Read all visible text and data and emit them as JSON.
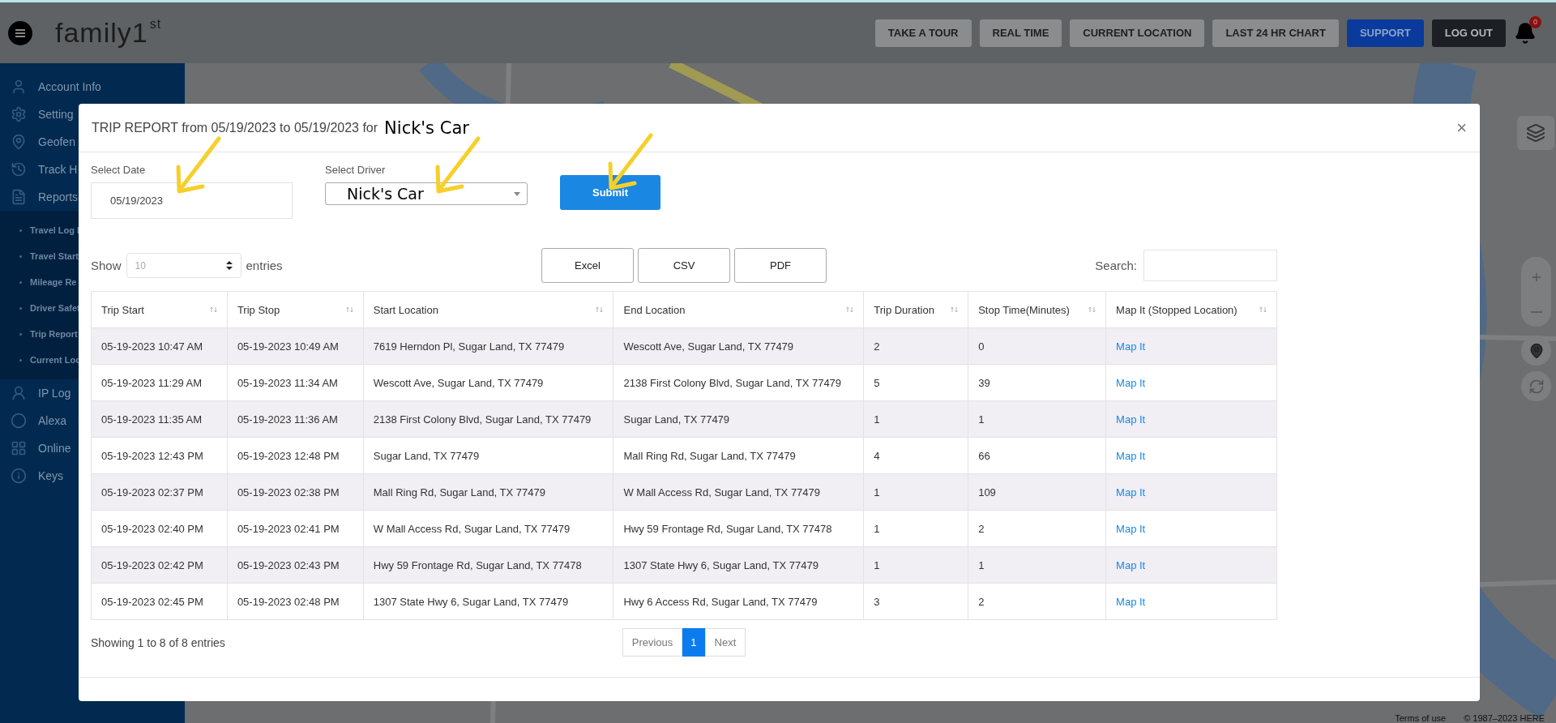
{
  "header": {
    "logo": "family1",
    "logo_sup": "st",
    "notifications": "0",
    "buttons": [
      {
        "label": "TAKE A TOUR",
        "kind": "default"
      },
      {
        "label": "REAL TIME",
        "kind": "default"
      },
      {
        "label": "CURRENT LOCATION",
        "kind": "default"
      },
      {
        "label": "LAST 24 HR CHART",
        "kind": "default"
      },
      {
        "label": "SUPPORT",
        "kind": "primary"
      },
      {
        "label": "LOG OUT",
        "kind": "dark"
      }
    ]
  },
  "sidebar": {
    "items": [
      {
        "label": "Account Info"
      },
      {
        "label": "Setting"
      },
      {
        "label": "Geofen"
      },
      {
        "label": "Track H"
      },
      {
        "label": "Reports",
        "expanded": true,
        "children": [
          {
            "label": "Travel Log I"
          },
          {
            "label": "Travel Start"
          },
          {
            "label": "Mileage Re"
          },
          {
            "label": "Driver Safet"
          },
          {
            "label": "Trip Report"
          },
          {
            "label": "Current Loc"
          }
        ]
      },
      {
        "label": "IP Log"
      },
      {
        "label": "Alexa"
      },
      {
        "label": "Online"
      },
      {
        "label": "Keys"
      }
    ]
  },
  "map": {
    "terms": "Terms of use",
    "copyright": "© 1987–2023 HERE"
  },
  "modal": {
    "title": "TRIP REPORT from 05/19/2023 to 05/19/2023 for",
    "title_vehicle": "Nick's Car",
    "close": "×",
    "date_label": "Select Date",
    "date_value": "05/19/2023",
    "driver_label": "Select Driver",
    "driver_value": "Nick's Car",
    "submit": "Submit",
    "show_label": "Show",
    "page_length": "10",
    "entries_label": "entries",
    "export_buttons": [
      "Excel",
      "CSV",
      "PDF"
    ],
    "search_label": "Search:",
    "table": {
      "columns": [
        {
          "label": "Trip Start",
          "kind": "text"
        },
        {
          "label": "Trip Stop",
          "kind": "text"
        },
        {
          "label": "Start Location",
          "kind": "text"
        },
        {
          "label": "End Location",
          "kind": "text"
        },
        {
          "label": "Trip Duration",
          "kind": "text"
        },
        {
          "label": "Stop Time(Minutes)",
          "kind": "text"
        },
        {
          "label": "Map It (Stopped Location)",
          "kind": "link"
        }
      ],
      "rows": [
        [
          "05-19-2023 10:47 AM",
          "05-19-2023 10:49 AM",
          "7619 Herndon Pl, Sugar Land, TX 77479",
          "Wescott Ave, Sugar Land, TX 77479",
          "2",
          "0",
          "Map It"
        ],
        [
          "05-19-2023 11:29 AM",
          "05-19-2023 11:34 AM",
          "Wescott Ave, Sugar Land, TX 77479",
          "2138 First Colony Blvd, Sugar Land, TX 77479",
          "5",
          "39",
          "Map It"
        ],
        [
          "05-19-2023 11:35 AM",
          "05-19-2023 11:36 AM",
          "2138 First Colony Blvd, Sugar Land, TX 77479",
          "Sugar Land, TX 77479",
          "1",
          "1",
          "Map It"
        ],
        [
          "05-19-2023 12:43 PM",
          "05-19-2023 12:48 PM",
          "Sugar Land, TX 77479",
          "Mall Ring Rd, Sugar Land, TX 77479",
          "4",
          "66",
          "Map It"
        ],
        [
          "05-19-2023 02:37 PM",
          "05-19-2023 02:38 PM",
          "Mall Ring Rd, Sugar Land, TX 77479",
          "W Mall Access Rd, Sugar Land, TX 77479",
          "1",
          "109",
          "Map It"
        ],
        [
          "05-19-2023 02:40 PM",
          "05-19-2023 02:41 PM",
          "W Mall Access Rd, Sugar Land, TX 77479",
          "Hwy 59 Frontage Rd, Sugar Land, TX 77478",
          "1",
          "2",
          "Map It"
        ],
        [
          "05-19-2023 02:42 PM",
          "05-19-2023 02:43 PM",
          "Hwy 59 Frontage Rd, Sugar Land, TX 77478",
          "1307 State Hwy 6, Sugar Land, TX 77479",
          "1",
          "1",
          "Map It"
        ],
        [
          "05-19-2023 02:45 PM",
          "05-19-2023 02:48 PM",
          "1307 State Hwy 6, Sugar Land, TX 77479",
          "Hwy 6 Access Rd, Sugar Land, TX 77479",
          "3",
          "2",
          "Map It"
        ]
      ]
    },
    "info": "Showing 1 to 8 of 8 entries",
    "pagination": [
      {
        "label": "Previous",
        "selected": false
      },
      {
        "label": "1",
        "selected": true
      },
      {
        "label": "Next",
        "selected": false
      }
    ]
  }
}
